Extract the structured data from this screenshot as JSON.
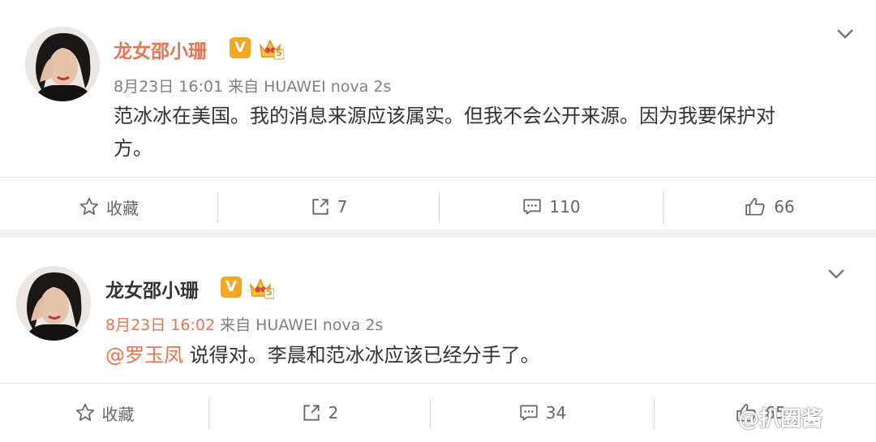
{
  "posts": [
    {
      "author": "龙女邵小珊",
      "verified_badge": "V",
      "level_badge": "5",
      "date": "8月23日 16:01",
      "source": "来自 HUAWEI nova 2s",
      "content": "范冰冰在美国。我的消息来源应该属实。但我不会公开来源。因为我要保护对方。",
      "content_line1": "范冰冰在美国。我的消息来源应该属实。但我不会公开来源。因为我要保护对",
      "content_line2": "方。",
      "favorite_label": "收藏",
      "repost_count": "7",
      "comment_count": "110",
      "like_count": "66"
    },
    {
      "author": "龙女邵小珊",
      "verified_badge": "V",
      "level_badge": "5",
      "date": "8月23日 16:02",
      "source": "来自 HUAWEI nova 2s",
      "mention": "@罗玉凤",
      "content": "说得对。李晨和范冰冰应该已经分手了。",
      "favorite_label": "收藏",
      "repost_count": "2",
      "comment_count": "34",
      "like_count": "65"
    }
  ],
  "watermark": "@扒圈酱",
  "colors": {
    "accent": "#eb7350",
    "badge": "#f5a623",
    "text": "#333333",
    "muted": "#808080"
  }
}
